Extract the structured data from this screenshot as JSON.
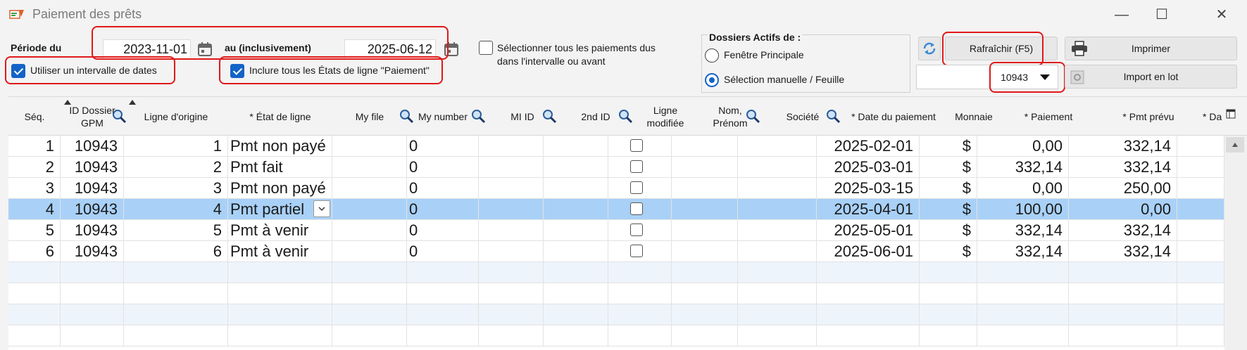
{
  "window": {
    "title": "Paiement des prêts",
    "minimize": "—",
    "maximize": "☐",
    "close": "✕"
  },
  "filters": {
    "period_label": "Période du",
    "date_from": "2023-11-01",
    "to_label": "au (inclusivement)",
    "date_to": "2025-06-12",
    "use_interval_label": "Utiliser un intervalle de dates",
    "use_interval_checked": true,
    "include_states_label": "Inclure tous les États de ligne \"Paiement\"",
    "include_states_checked": true,
    "select_all_line1": "Sélectionner tous les paiements dus",
    "select_all_line2": "dans l'intervalle ou avant",
    "select_all_checked": false
  },
  "dossiers": {
    "title": "Dossiers Actifs de :",
    "option1": "Fenêtre Principale",
    "option2": "Sélection manuelle / Feuille",
    "selected": "option2"
  },
  "actions": {
    "refresh_label": "Rafraîchir (F5)",
    "print_label": "Imprimer",
    "import_label": "Import en lot",
    "dossier_select_value": "10943"
  },
  "colors": {
    "accent": "#1463c8",
    "selected_row": "#a9d1f7",
    "highlight": "#e01818"
  },
  "table": {
    "headers": {
      "seq": "Séq.",
      "id_dossier_1": "ID Dossier",
      "id_dossier_2": "GPM",
      "ligne_origine": "Ligne d'origine",
      "etat": "* État de ligne",
      "my_file": "My file",
      "my_number": "My number",
      "mi_id": "MI ID",
      "second_id": "2nd ID",
      "ligne_mod_1": "Ligne",
      "ligne_mod_2": "modifiée",
      "nom_1": "Nom,",
      "nom_2": "Prénom",
      "societe": "Société",
      "date_paiement": "* Date du paiement",
      "monnaie": "Monnaie",
      "paiement": "* Paiement",
      "pmt_prevu": "* Pmt prévu",
      "da": "* Da"
    },
    "rows": [
      {
        "seq": "1",
        "id": "10943",
        "ligne": "1",
        "etat": "Pmt non payé",
        "my_number": "0",
        "date": "2025-02-01",
        "monnaie": "$",
        "paiement": "0,00",
        "prevu": "332,14"
      },
      {
        "seq": "2",
        "id": "10943",
        "ligne": "2",
        "etat": "Pmt fait",
        "my_number": "0",
        "date": "2025-03-01",
        "monnaie": "$",
        "paiement": "332,14",
        "prevu": "332,14"
      },
      {
        "seq": "3",
        "id": "10943",
        "ligne": "3",
        "etat": "Pmt non payé",
        "my_number": "0",
        "date": "2025-03-15",
        "monnaie": "$",
        "paiement": "0,00",
        "prevu": "250,00"
      },
      {
        "seq": "4",
        "id": "10943",
        "ligne": "4",
        "etat": "Pmt partiel",
        "my_number": "0",
        "date": "2025-04-01",
        "monnaie": "$",
        "paiement": "100,00",
        "prevu": "0,00"
      },
      {
        "seq": "5",
        "id": "10943",
        "ligne": "5",
        "etat": "Pmt à venir",
        "my_number": "0",
        "date": "2025-05-01",
        "monnaie": "$",
        "paiement": "332,14",
        "prevu": "332,14"
      },
      {
        "seq": "6",
        "id": "10943",
        "ligne": "6",
        "etat": "Pmt à venir",
        "my_number": "0",
        "date": "2025-06-01",
        "monnaie": "$",
        "paiement": "332,14",
        "prevu": "332,14"
      }
    ],
    "selected_row_index": 3
  }
}
